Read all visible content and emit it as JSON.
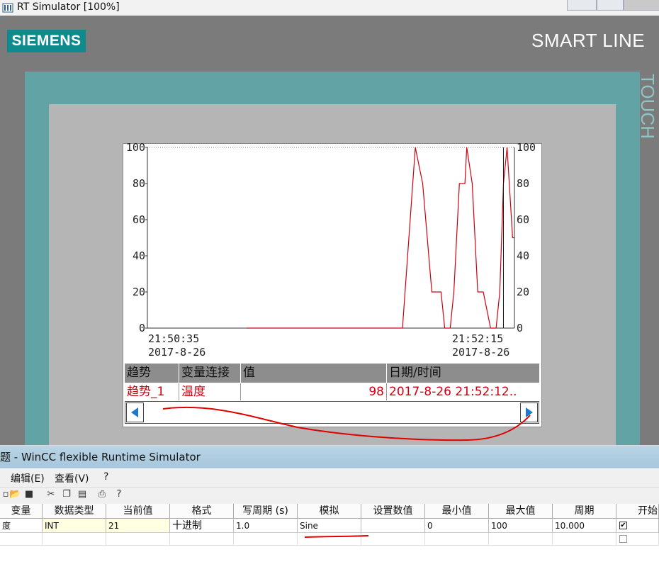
{
  "simulator": {
    "title": "RT Simulator [100%]",
    "brand": "SIEMENS",
    "model": "SMART LINE",
    "side_label": "TOUCH"
  },
  "chart_data": {
    "type": "line",
    "title": "",
    "ylim": [
      0,
      100
    ],
    "y_ticks_left": [
      "100",
      "80",
      "60",
      "40",
      "20",
      "0"
    ],
    "y_ticks_right": [
      "100",
      "80",
      "60",
      "40",
      "20",
      "0"
    ],
    "x_start": {
      "time": "21:50:35",
      "date": "2017-8-26"
    },
    "x_end": {
      "time": "21:52:15",
      "date": "2017-8-26"
    },
    "xlim_seconds": [
      0,
      100
    ],
    "cursor_seconds": 97,
    "series": [
      {
        "name": "趋势_1",
        "color": "#d00010",
        "x": [
          27,
          69.5,
          73,
          75,
          77.5,
          80,
          81,
          82.5,
          83.5,
          85,
          86.5,
          87,
          88.5,
          89,
          90,
          91.5,
          93.5,
          95,
          96,
          97,
          98,
          99.5,
          100
        ],
        "y": [
          0,
          0,
          100,
          80,
          20,
          20,
          0,
          0,
          20,
          80,
          80,
          100,
          80,
          60,
          20,
          20,
          0,
          0,
          20,
          80,
          100,
          50,
          50
        ]
      }
    ]
  },
  "trend_table": {
    "headers": [
      "趋势",
      "变量连接",
      "值",
      "日期/时间"
    ],
    "row": {
      "trend": "趋势_1",
      "tag": "温度",
      "value": "98",
      "datetime": "2017-8-26  21:52:12.."
    }
  },
  "runtime": {
    "title": "题 - WinCC flexible Runtime Simulator",
    "menu": [
      "编辑(E)",
      "查看(V)",
      "?"
    ],
    "columns": [
      "变量",
      "数据类型",
      "当前值",
      "格式",
      "写周期 (s)",
      "模拟",
      "设置数值",
      "最小值",
      "最大值",
      "周期",
      "开始"
    ],
    "row": {
      "tag": "度",
      "type": "INT",
      "current": "21",
      "format": "十进制",
      "write_cycle": "1.0",
      "simulation": "Sine",
      "set_value": "",
      "min": "0",
      "max": "100",
      "period": "10.000",
      "start_checked": true
    }
  },
  "colors": {
    "bezel": "#62a3a6",
    "brand": "#0f8b8d",
    "trend_line": "#d00010",
    "table_header": "#8d8d8d"
  }
}
